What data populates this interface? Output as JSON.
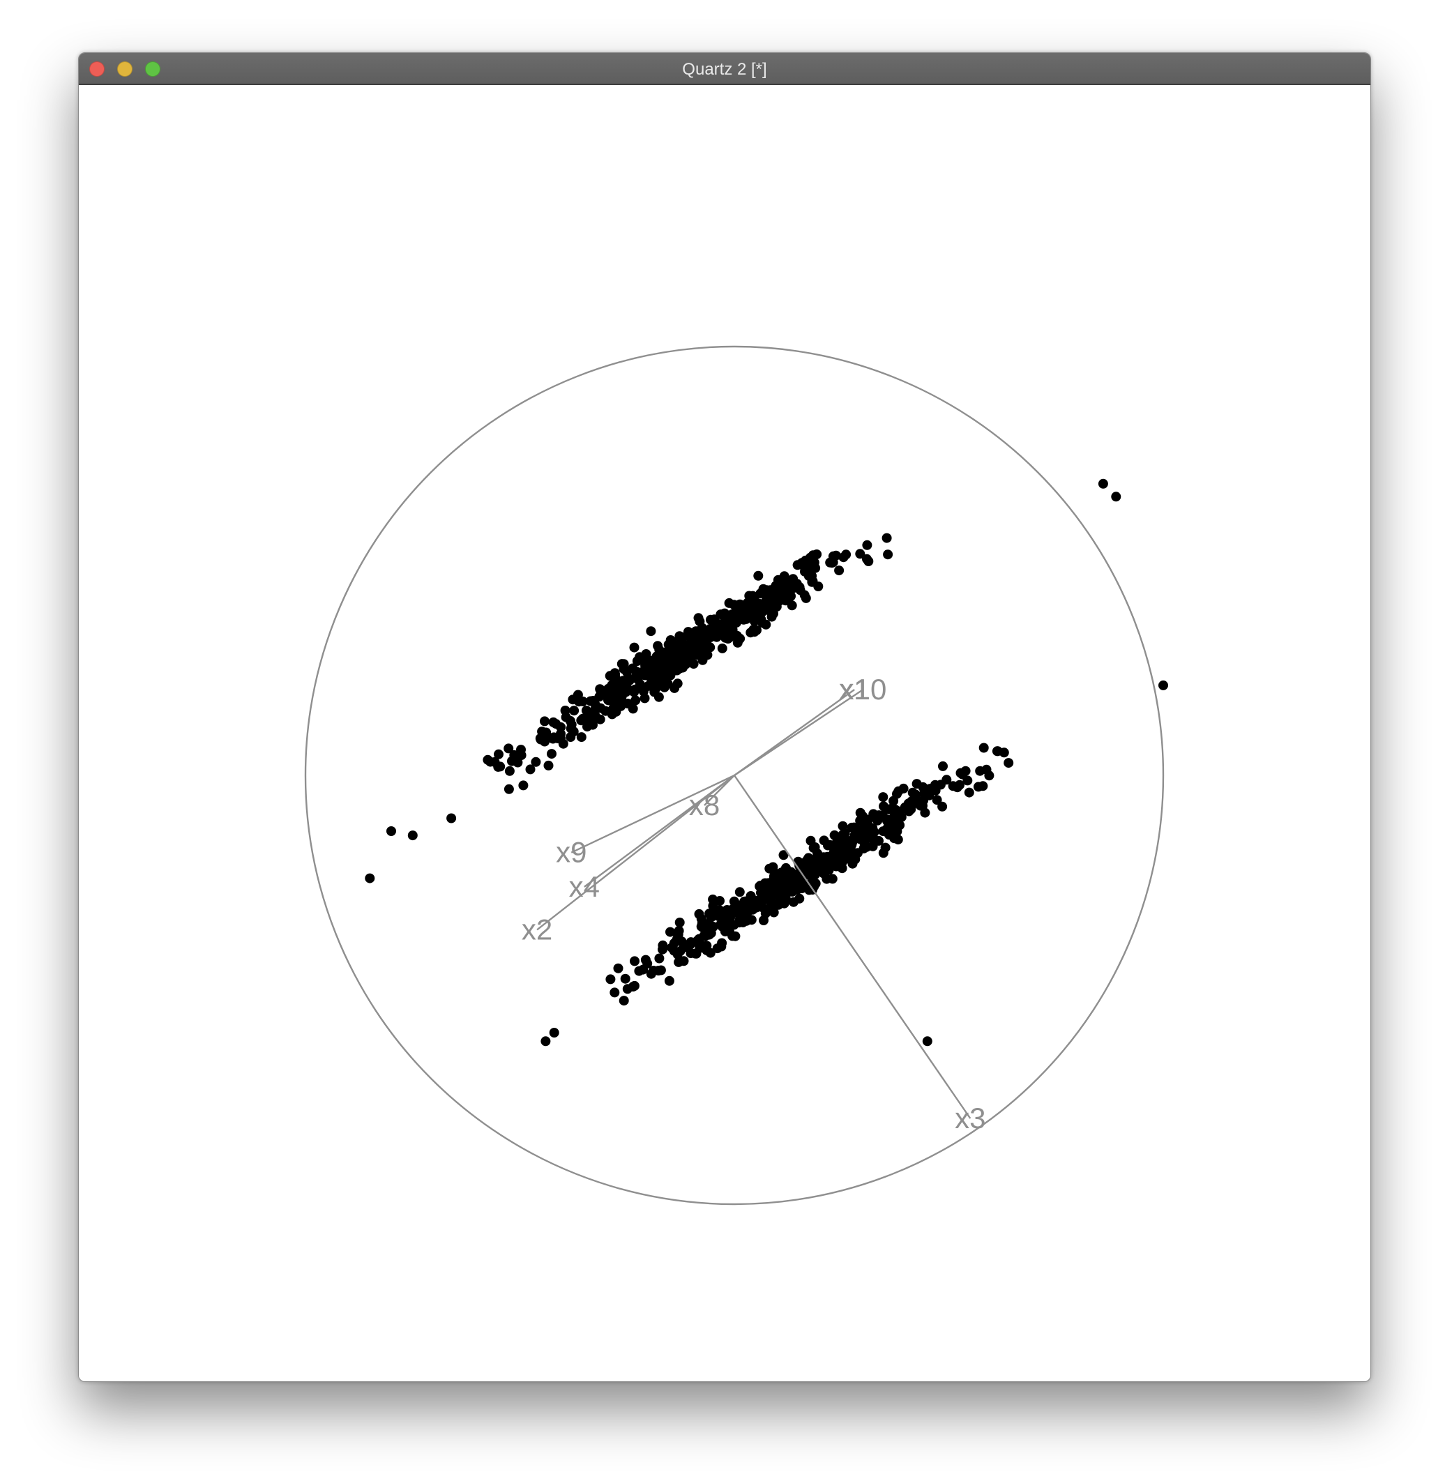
{
  "window": {
    "title": "Quartz 2 [*]",
    "traffic_lights": {
      "close_color": "#ee5e56",
      "minimize_color": "#e0b53c",
      "zoom_color": "#5fc344"
    }
  },
  "chart_data": {
    "type": "scatter",
    "title": "",
    "xlabel": "",
    "ylabel": "",
    "grid": false,
    "plot_range": [
      -1,
      1
    ],
    "unit_circle": true,
    "axes": [
      {
        "name": "x10",
        "x": 0.3,
        "y": 0.2
      },
      {
        "name": "x1",
        "x": 0.28,
        "y": 0.2
      },
      {
        "name": "x8",
        "x": -0.07,
        "y": -0.07
      },
      {
        "name": "x9",
        "x": -0.38,
        "y": -0.18
      },
      {
        "name": "x4",
        "x": -0.35,
        "y": -0.26
      },
      {
        "name": "x2",
        "x": -0.46,
        "y": -0.36
      },
      {
        "name": "x3",
        "x": 0.55,
        "y": -0.8
      }
    ],
    "series": [
      {
        "color": "#000000",
        "center": [
          -0.11,
          0.29
        ],
        "direction": [
          0.85,
          0.53
        ],
        "extent": 0.55,
        "spread": 0.022,
        "count": 450
      },
      {
        "color": "#000000",
        "center": [
          0.16,
          -0.23
        ],
        "direction": [
          0.85,
          0.53
        ],
        "extent": 0.55,
        "spread": 0.022,
        "count": 450
      }
    ],
    "outliers": [
      {
        "x": -0.85,
        "y": -0.24
      },
      {
        "x": -0.8,
        "y": -0.13
      },
      {
        "x": -0.75,
        "y": -0.14
      },
      {
        "x": -0.66,
        "y": -0.1
      },
      {
        "x": 0.89,
        "y": 0.65
      },
      {
        "x": 0.86,
        "y": 0.68
      },
      {
        "x": 0.45,
        "y": -0.62
      },
      {
        "x": -0.44,
        "y": -0.62
      },
      {
        "x": -0.42,
        "y": -0.6
      },
      {
        "x": 1.0,
        "y": 0.21
      }
    ]
  }
}
